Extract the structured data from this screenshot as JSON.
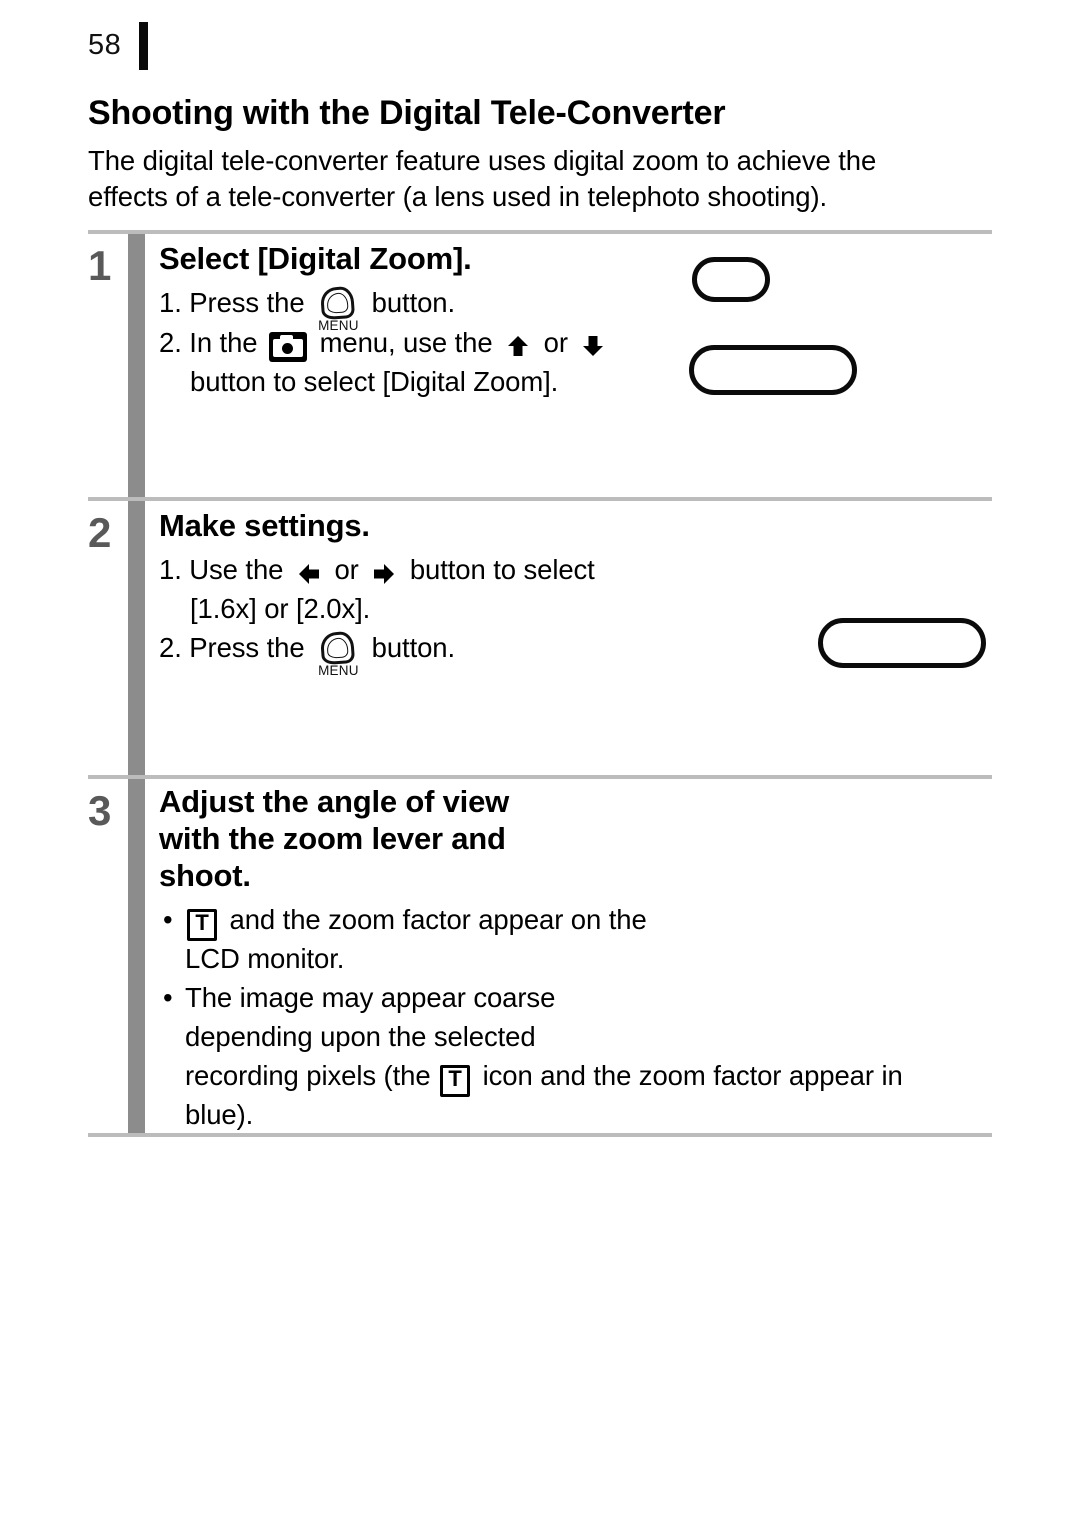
{
  "page": {
    "number": "58"
  },
  "section": {
    "title": "Shooting with the Digital Tele-Converter",
    "intro_line1": "The digital tele-converter feature uses digital zoom to achieve the",
    "intro_line2": "effects of a tele-converter (a lens used in telephoto shooting)."
  },
  "icons": {
    "menu_label": "MENU",
    "t_label": "T"
  },
  "steps": [
    {
      "number": "1",
      "heading": "Select [Digital Zoom].",
      "lines": {
        "l1_a": "1. Press the",
        "l1_b": "button.",
        "l2_a": "2. In the",
        "l2_b": "menu, use the",
        "l2_c": "or",
        "l3": "button to select [Digital Zoom]."
      }
    },
    {
      "number": "2",
      "heading": "Make settings.",
      "lines": {
        "l1_a": "1. Use the",
        "l1_b": "or",
        "l1_c": "button to select",
        "l2": "[1.6x] or [2.0x].",
        "l3_a": "2. Press the",
        "l3_b": "button."
      }
    },
    {
      "number": "3",
      "heading_l1": "Adjust the angle of view",
      "heading_l2": "with the zoom lever and",
      "heading_l3": "shoot.",
      "bullet": "•",
      "lines": {
        "b1_a": "and the zoom factor appear on the",
        "b1_b": "LCD monitor.",
        "b2_a": "The image may appear coarse",
        "b2_b": "depending upon the selected",
        "b2_c": "recording pixels (the",
        "b2_d": "icon and the zoom factor appear in",
        "b2_e": "blue)."
      }
    }
  ],
  "colors": {
    "rail": "#8c8c8c",
    "separator": "#bcbcbc",
    "step_number": "#595959",
    "text": "#000000"
  }
}
